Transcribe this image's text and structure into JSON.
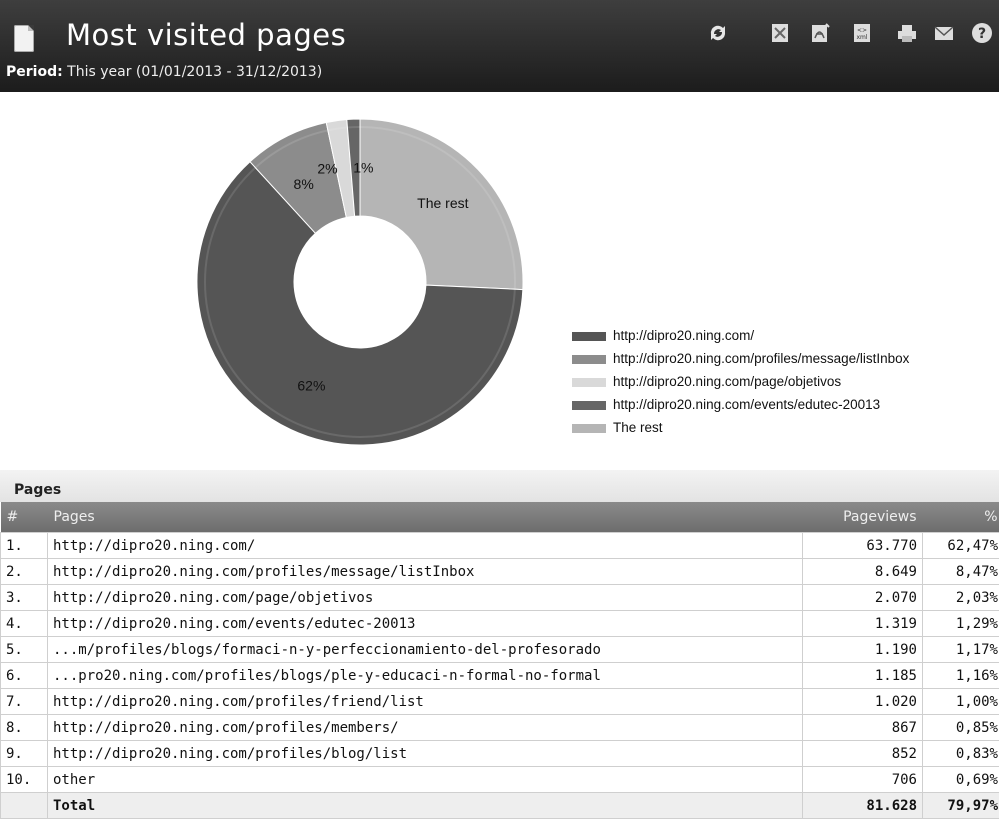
{
  "header": {
    "title": "Most visited pages",
    "period_label": "Period:",
    "period_value": "This year (01/01/2013 - 31/12/2013)"
  },
  "toolbar": [
    {
      "name": "refresh-icon"
    },
    {
      "name": "excel-export-icon"
    },
    {
      "name": "pdf-export-icon"
    },
    {
      "name": "xml-export-icon"
    },
    {
      "name": "print-icon"
    },
    {
      "name": "email-icon"
    },
    {
      "name": "help-icon"
    }
  ],
  "chart_data": {
    "type": "pie",
    "categories": [
      "http://dipro20.ning.com/",
      "http://dipro20.ning.com/profiles/message/listInbox",
      "http://dipro20.ning.com/page/objetivos",
      "http://dipro20.ning.com/events/edutec-20013",
      "The rest"
    ],
    "values": [
      62.47,
      8.47,
      2.03,
      1.29,
      25.74
    ],
    "labels": [
      "62%",
      "8%",
      "2%",
      "1%",
      "The rest"
    ],
    "colors": [
      "#555555",
      "#8c8c8c",
      "#d9d9d9",
      "#666666",
      "#b5b5b5"
    ],
    "legend": "right"
  },
  "table": {
    "section_title": "Pages",
    "columns": [
      "#",
      "Pages",
      "Pageviews",
      "%"
    ],
    "rows": [
      {
        "n": "1.",
        "page": "http://dipro20.ning.com/",
        "views": "63.770",
        "pct": "62,47%"
      },
      {
        "n": "2.",
        "page": "http://dipro20.ning.com/profiles/message/listInbox",
        "views": "8.649",
        "pct": "8,47%"
      },
      {
        "n": "3.",
        "page": "http://dipro20.ning.com/page/objetivos",
        "views": "2.070",
        "pct": "2,03%"
      },
      {
        "n": "4.",
        "page": "http://dipro20.ning.com/events/edutec-20013",
        "views": "1.319",
        "pct": "1,29%"
      },
      {
        "n": "5.",
        "page": "...m/profiles/blogs/formaci-n-y-perfeccionamiento-del-profesorado",
        "views": "1.190",
        "pct": "1,17%"
      },
      {
        "n": "6.",
        "page": "...pro20.ning.com/profiles/blogs/ple-y-educaci-n-formal-no-formal",
        "views": "1.185",
        "pct": "1,16%"
      },
      {
        "n": "7.",
        "page": "http://dipro20.ning.com/profiles/friend/list",
        "views": "1.020",
        "pct": "1,00%"
      },
      {
        "n": "8.",
        "page": "http://dipro20.ning.com/profiles/members/",
        "views": "867",
        "pct": "0,85%"
      },
      {
        "n": "9.",
        "page": "http://dipro20.ning.com/profiles/blog/list",
        "views": "852",
        "pct": "0,83%"
      },
      {
        "n": "10.",
        "page": "other",
        "views": "706",
        "pct": "0,69%"
      }
    ],
    "total": {
      "label": "Total",
      "views": "81.628",
      "pct": "79,97%"
    }
  }
}
